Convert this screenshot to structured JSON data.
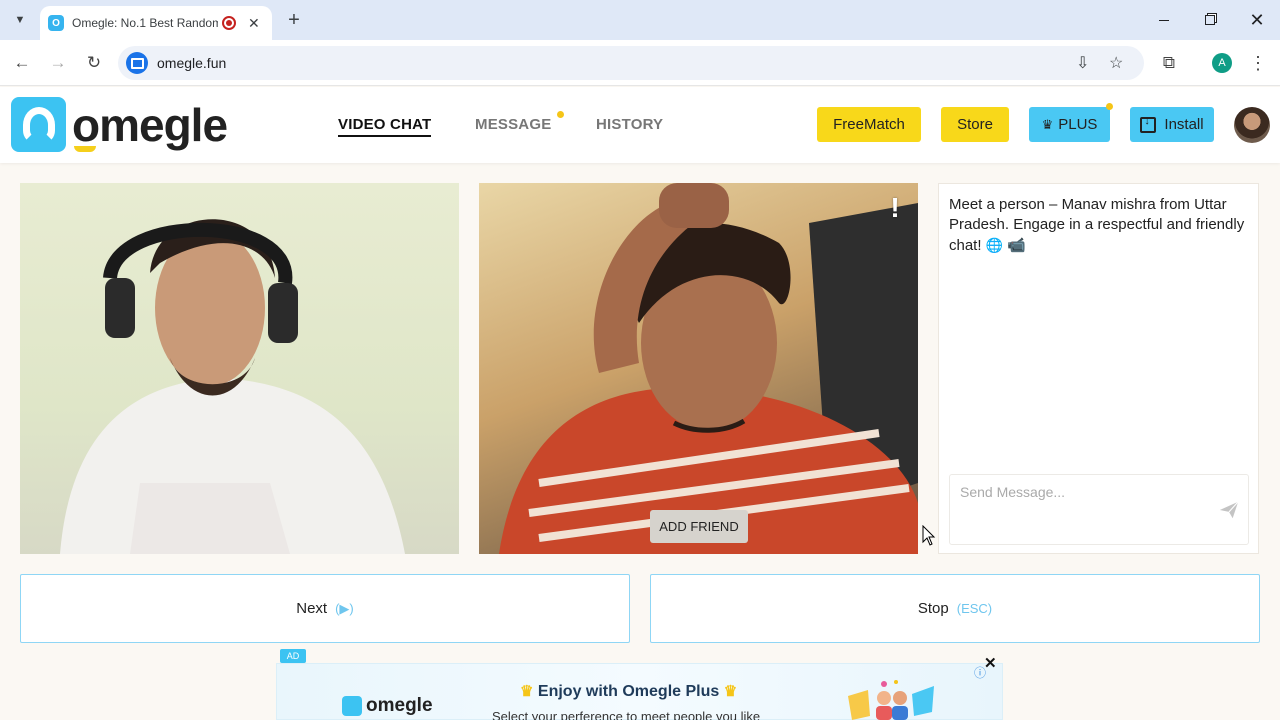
{
  "browser": {
    "tab_title": "Omegle: No.1 Best Random",
    "tab_favicon_letter": "O",
    "url": "omegle.fun",
    "profile_initial": "A"
  },
  "site": {
    "logo_text": "omegle",
    "nav": [
      {
        "label": "VIDEO CHAT",
        "active": true
      },
      {
        "label": "MESSAGE",
        "active": false,
        "has_dot": true
      },
      {
        "label": "HISTORY",
        "active": false
      }
    ],
    "buttons": {
      "freematch": "FreeMatch",
      "store": "Store",
      "plus": "PLUS",
      "install": "Install"
    }
  },
  "video": {
    "add_friend_label": "ADD FRIEND",
    "report_label": "!"
  },
  "chat": {
    "intro_message": "Meet a person – Manav mishra from Uttar Pradesh. Engage in a respectful and friendly chat!",
    "input_placeholder": "Send Message..."
  },
  "controls": {
    "next_label": "Next",
    "next_hint": "(▶)",
    "stop_label": "Stop",
    "stop_hint": "(ESC)"
  },
  "ad": {
    "tag": "AD",
    "logo_text": "omegle",
    "title": "Enjoy with Omegle Plus",
    "subtitle": "Select your perference to meet people you like"
  },
  "colors": {
    "brand_blue": "#3cc3f2",
    "brand_yellow": "#f8d81a",
    "accent_border": "#8fd6f5"
  }
}
